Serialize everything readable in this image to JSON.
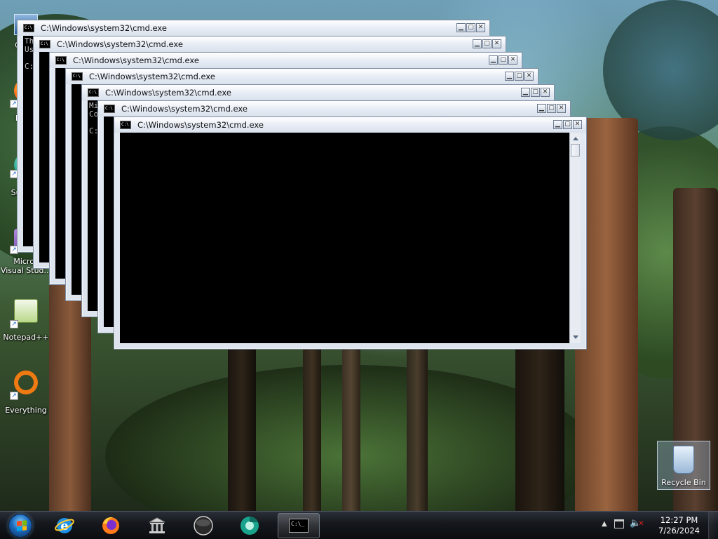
{
  "desktop": {
    "icons": [
      {
        "id": "computer",
        "label": "Comp"
      },
      {
        "id": "firefox",
        "label": "Firefo"
      },
      {
        "id": "supermium",
        "label": "Superm"
      },
      {
        "id": "visual-studio",
        "label": "Micros\nVisual Stud..."
      },
      {
        "id": "notepadpp",
        "label": "Notepad++"
      },
      {
        "id": "everything",
        "label": "Everything"
      }
    ],
    "recycle_bin": {
      "label": "Recycle Bin"
    }
  },
  "windows": [
    {
      "title": "C:\\Windows\\system32\\cmd.exe",
      "console": "Th\nUs\n\nC:"
    },
    {
      "title": "C:\\Windows\\system32\\cmd.exe",
      "console": ""
    },
    {
      "title": "C:\\Windows\\system32\\cmd.exe",
      "console": ""
    },
    {
      "title": "C:\\Windows\\system32\\cmd.exe",
      "console": ""
    },
    {
      "title": "C:\\Windows\\system32\\cmd.exe",
      "console": "Mi\nCo\n\nC:"
    },
    {
      "title": "C:\\Windows\\system32\\cmd.exe",
      "console": ""
    },
    {
      "title": "C:\\Windows\\system32\\cmd.exe",
      "console": ""
    }
  ],
  "taskbar": {
    "pinned": [
      "internet-explorer",
      "firefox",
      "library",
      "obs",
      "supermium",
      "cmd"
    ],
    "clock": {
      "time": "12:27 PM",
      "date": "7/26/2024"
    }
  }
}
